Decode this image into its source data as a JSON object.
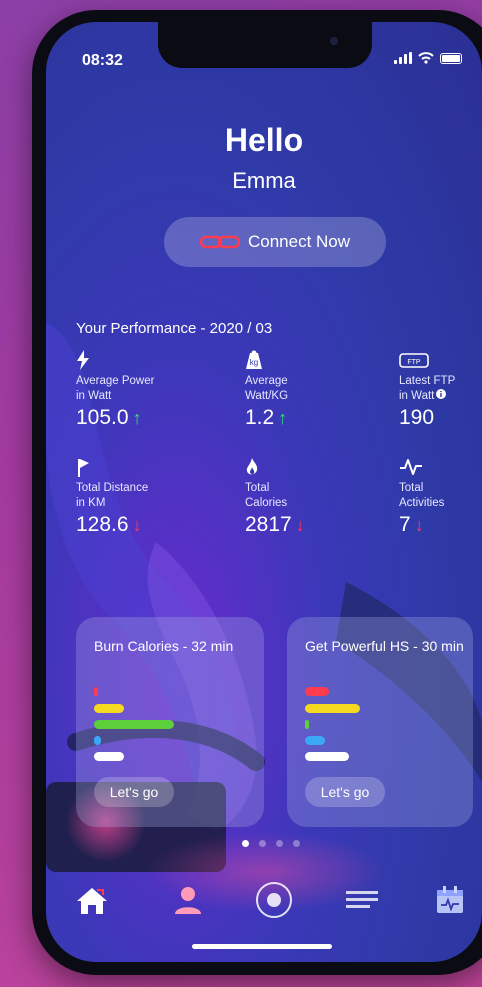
{
  "status": {
    "time": "08:32"
  },
  "greeting": {
    "hello": "Hello",
    "name": "Emma"
  },
  "connect": {
    "label": "Connect Now",
    "icon": "chain-link-icon",
    "icon_color": "#ff3b4f"
  },
  "performance": {
    "title": "Your Performance - 2020 / 03",
    "stats": [
      {
        "icon": "lightning-icon",
        "label": "Average Power\nin Watt",
        "value": "105.0",
        "trend": "↑",
        "trend_dir": "up"
      },
      {
        "icon": "weight-icon",
        "label": "Average\nWatt/KG",
        "value": "1.2",
        "trend": "↑",
        "trend_dir": "up"
      },
      {
        "icon": "ftp-icon",
        "icon_text": "FTP",
        "label": "Latest FTP\nin Watt",
        "value": "190",
        "trend": "",
        "trend_dir": "none"
      },
      {
        "icon": "flag-icon",
        "label": "Total Distance\nin KM",
        "value": "128.6",
        "trend": "↓",
        "trend_dir": "down"
      },
      {
        "icon": "flame-icon",
        "label": "Total\nCalories",
        "value": "2817",
        "trend": "↓",
        "trend_dir": "down"
      },
      {
        "icon": "pulse-icon",
        "label": "Total\nActivities",
        "value": "7",
        "trend": "↓",
        "trend_dir": "down"
      }
    ]
  },
  "workouts": [
    {
      "title": "Burn Calories - 32 min",
      "button": "Let's go"
    },
    {
      "title": "Get Powerful HS - 30 min",
      "button": "Let's go"
    }
  ],
  "colors": {
    "red": "#ff3b4f",
    "yellow": "#f5d921",
    "green": "#5ccf3a",
    "blue": "#3ba8f5",
    "white": "#ffffff",
    "up": "#36e07a"
  },
  "pager": {
    "count": 4,
    "active": 0
  },
  "tabbar": [
    "home-icon",
    "profile-icon",
    "record-icon",
    "list-icon",
    "calendar-icon"
  ]
}
